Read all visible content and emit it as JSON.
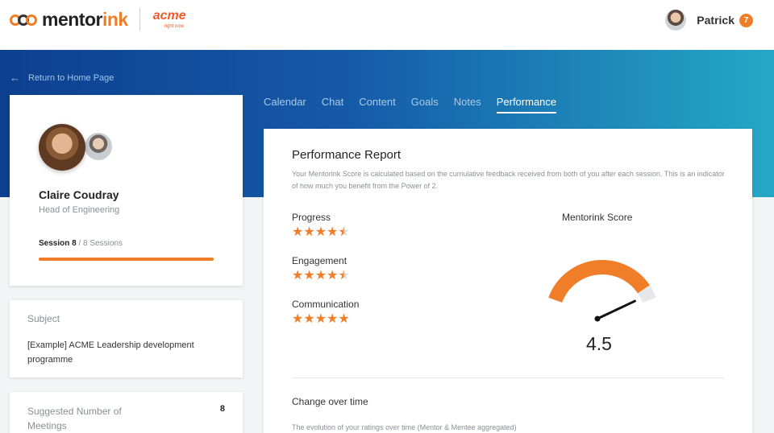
{
  "header": {
    "brand": {
      "prefix": "mentor",
      "suffix": "ink"
    },
    "partner": {
      "name": "acme",
      "tagline": "right now"
    },
    "user": {
      "name": "Patrick",
      "notifications": "7"
    }
  },
  "nav": {
    "back_label": "Return to Home Page",
    "back_icon": "arrow-left-icon"
  },
  "profile": {
    "name": "Claire Coudray",
    "role": "Head of Engineering",
    "session_current": "Session 8",
    "session_total": "/ 8 Sessions",
    "session_progress": 1.0
  },
  "subject": {
    "label": "Subject",
    "value": "[Example] ACME Leadership development programme"
  },
  "meetings": {
    "label": "Suggested Number of Meetings",
    "value": "8"
  },
  "tabs": [
    {
      "label": "Calendar",
      "active": false
    },
    {
      "label": "Chat",
      "active": false
    },
    {
      "label": "Content",
      "active": false
    },
    {
      "label": "Goals",
      "active": false
    },
    {
      "label": "Notes",
      "active": false
    },
    {
      "label": "Performance",
      "active": true
    }
  ],
  "report": {
    "title": "Performance Report",
    "description": "Your Mentorink Score is calculated based on the cumulative feedback received from both of you after each session. This is an indicator of how much you benefit from the Power of 2.",
    "metrics": [
      {
        "label": "Progress",
        "rating": 4.5
      },
      {
        "label": "Engagement",
        "rating": 4.5
      },
      {
        "label": "Communication",
        "rating": 5
      }
    ],
    "score_label": "Mentorink Score",
    "score_value": "4.5",
    "score_max": 5,
    "change_title": "Change over time",
    "change_desc": "The evolution of your ratings over time (Mentor & Mentee aggregated)"
  },
  "colors": {
    "accent": "#f07d28",
    "hero_start": "#0e3f8f",
    "hero_end": "#24a8c6"
  }
}
